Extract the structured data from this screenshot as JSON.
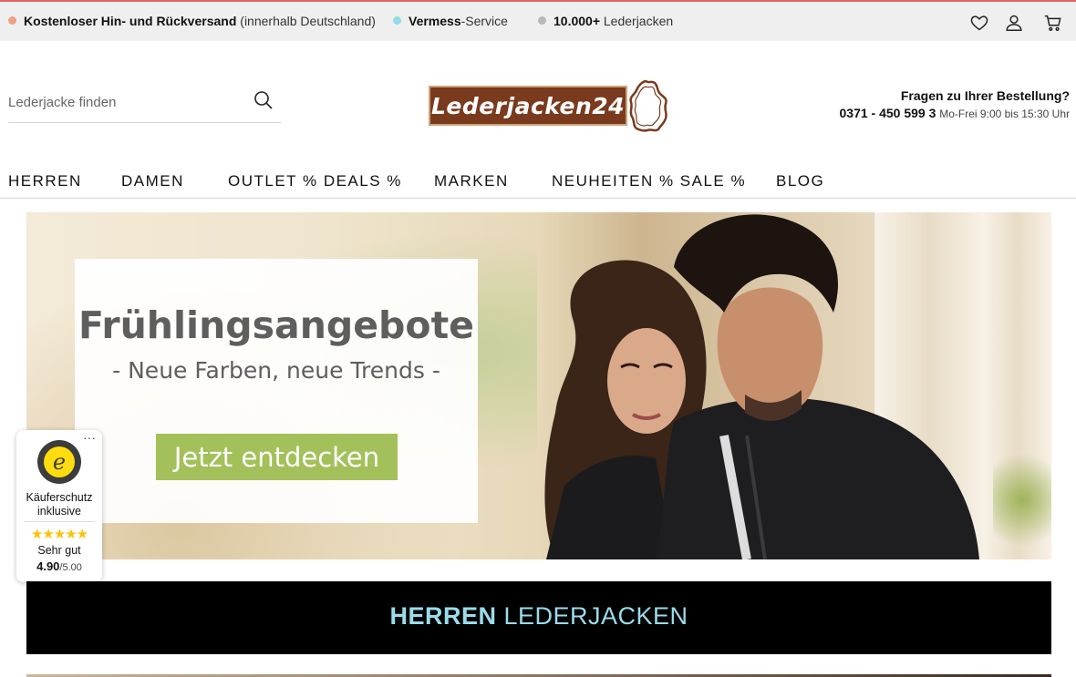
{
  "topbar": {
    "usps": [
      {
        "bold": "Kostenloser Hin- und Rückversand",
        "rest": " (innerhalb Deutschland)",
        "dot_color": "#f0a088"
      },
      {
        "bold": "Vermess",
        "rest": "-Service",
        "dot_color": "#8fdcea"
      },
      {
        "bold": "10.000+",
        "rest": " Lederjacken",
        "dot_color": "#b8b8b8"
      }
    ],
    "icons": [
      "heart-icon",
      "user-icon",
      "cart-icon"
    ]
  },
  "header": {
    "search_placeholder": "Lederjacke finden",
    "logo_text": "Lederjacken24",
    "hotline_question": "Fragen zu Ihrer Bestellung?",
    "hotline_number": "0371 - 450 599 3",
    "hotline_hours": "Mo-Frei 9:00 bis 15:30 Uhr"
  },
  "nav": {
    "items": [
      "HERREN",
      "DAMEN",
      "OUTLET % DEALS %",
      "MARKEN",
      "NEUHEITEN % SALE %",
      "BLOG"
    ]
  },
  "hero": {
    "title": "Frühlingsangebote",
    "subtitle": "- Neue Farben, neue Trends -",
    "button_label": "Jetzt entdecken",
    "button_color": "#a4c05a"
  },
  "trusted_shops": {
    "more": "···",
    "label": "Käuferschutz inklusive",
    "stars": "★★★★★",
    "grade": "Sehr gut",
    "score": "4.90",
    "score_max": "/5.00",
    "star_color": "#ffc107"
  },
  "category_banner": {
    "bold": "HERREN",
    "rest": " LEDERJACKEN",
    "text_color": "#9adcea"
  }
}
